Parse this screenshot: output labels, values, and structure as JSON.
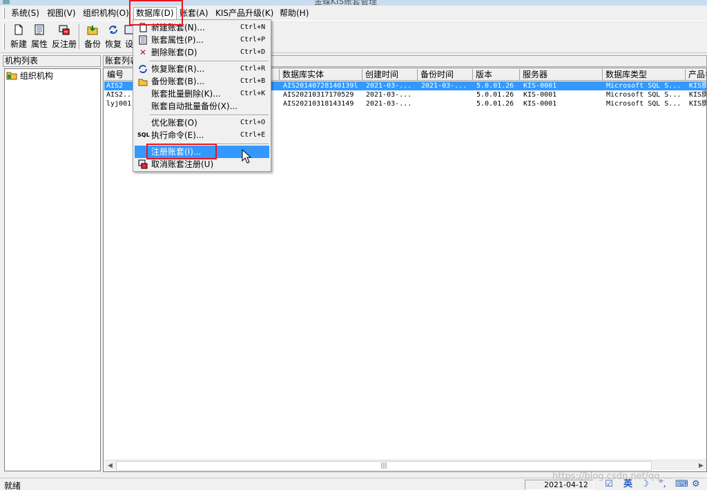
{
  "window": {
    "title": "金蝶KIS账套管理"
  },
  "menubar": {
    "items": [
      "系统(S)",
      "视图(V)",
      "组织机构(O)",
      "数据库(D)",
      "账套(A)",
      "KIS产品升级(K)",
      "帮助(H)"
    ]
  },
  "toolbar": {
    "buttons": [
      {
        "label": "新建",
        "icon": "new-document-icon"
      },
      {
        "label": "属性",
        "icon": "properties-icon"
      },
      {
        "label": "反注册",
        "icon": "unregister-icon"
      },
      {
        "label": "备份",
        "icon": "backup-icon"
      },
      {
        "label": "恢复",
        "icon": "restore-icon"
      },
      {
        "label": "设",
        "icon": "settings-icon"
      }
    ]
  },
  "left_panel": {
    "header": "机构列表",
    "tree_root": "组织机构"
  },
  "right_panel": {
    "header": "账套列表",
    "columns": [
      "编号",
      "数据库实体",
      "创建时间",
      "备份时间",
      "版本",
      "服务器",
      "数据库类型",
      "产品名"
    ],
    "rows": [
      {
        "id": "AIS2",
        "db": "AIS20140728140139l",
        "created": "2021-03-...",
        "backup": "2021-03-...",
        "version": "5.0.01.26",
        "server": "KIS-0001",
        "dbtype": "Microsoft SQL S...",
        "product": "KIS旗"
      },
      {
        "id": "AIS2...",
        "db": "AIS20210317170529",
        "created": "2021-03-...",
        "backup": "",
        "version": "5.0.01.26",
        "server": "KIS-0001",
        "dbtype": "Microsoft SQL S...",
        "product": "KIS旗"
      },
      {
        "id": "lyj001",
        "db": "AIS20210318143149",
        "created": "2021-03-...",
        "backup": "",
        "version": "5.0.01.26",
        "server": "KIS-0001",
        "dbtype": "Microsoft SQL S...",
        "product": "KIS旗"
      }
    ],
    "selected_row": 0
  },
  "dropdown": {
    "items": [
      {
        "label": "新建账套(N)...",
        "shortcut": "Ctrl+N",
        "icon": "new-document-icon"
      },
      {
        "label": "账套属性(P)...",
        "shortcut": "Ctrl+P",
        "icon": "properties-icon"
      },
      {
        "label": "删除账套(D)",
        "shortcut": "Ctrl+D",
        "icon": "delete-x-icon"
      },
      {
        "label": "恢复账套(R)...",
        "shortcut": "Ctrl+R",
        "icon": "restore-icon"
      },
      {
        "label": "备份账套(B)...",
        "shortcut": "Ctrl+B",
        "icon": "backup-icon"
      },
      {
        "label": "账套批量删除(K)...",
        "shortcut": "Ctrl+K",
        "icon": ""
      },
      {
        "label": "账套自动批量备份(X)...",
        "shortcut": "",
        "icon": ""
      },
      {
        "label": "优化账套(O)",
        "shortcut": "Ctrl+O",
        "icon": ""
      },
      {
        "label": "执行命令(E)...",
        "shortcut": "Ctrl+E",
        "icon": "sql-icon"
      },
      {
        "label": "注册账套(I)...",
        "shortcut": "",
        "icon": ""
      },
      {
        "label": "取消账套注册(U)",
        "shortcut": "",
        "icon": "unregister-icon"
      }
    ],
    "highlighted_index": 9
  },
  "statusbar": {
    "text": "就绪",
    "date": "2021-04-12",
    "ime": "英"
  },
  "watermark": "https://blog.csdn.net/qq_..."
}
